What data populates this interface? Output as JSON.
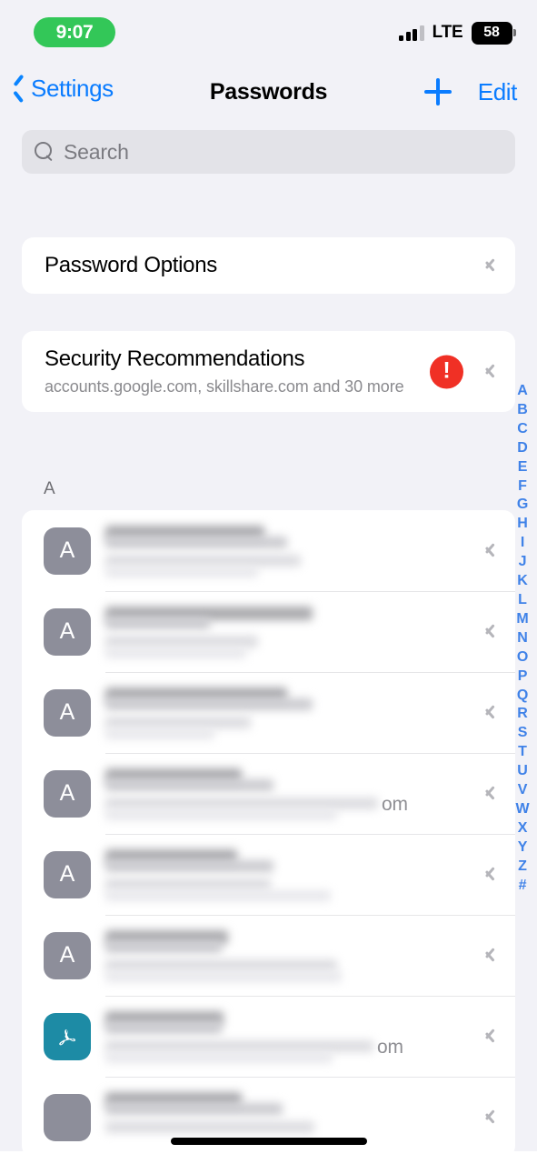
{
  "status_bar": {
    "time": "9:07",
    "time_pill_color": "#33C758",
    "carrier_tech": "LTE",
    "battery_level": "58",
    "signal_bars_filled": 3,
    "signal_bars_total": 4
  },
  "nav_bar": {
    "back_label": "Settings",
    "back_icon": "chevron-left-icon",
    "title": "Passwords",
    "add_icon": "plus-icon",
    "edit_label": "Edit",
    "accent_color": "#0A7CFF"
  },
  "search": {
    "placeholder": "Search",
    "value": "",
    "icon": "search-icon"
  },
  "password_options": {
    "label": "Password Options",
    "disclosure_icon": "chevron-right-icon"
  },
  "security_recommendations": {
    "title": "Security Recommendations",
    "subtitle": "accounts.google.com, skillshare.com and 30 more",
    "badge_icon": "exclamation-circle-icon",
    "badge_color": "#F03025",
    "disclosure_icon": "chevron-right-icon"
  },
  "section_header": "A",
  "password_list": [
    {
      "avatar_letter": "A",
      "avatar_style": "gray",
      "redacted": true,
      "title_widths": [
        175,
        200
      ],
      "sub_widths": [
        215,
        168
      ],
      "tail_text": ""
    },
    {
      "avatar_letter": "A",
      "avatar_style": "gray",
      "redacted": true,
      "title_widths": [
        228,
        115
      ],
      "sub_widths": [
        168,
        155
      ],
      "tail_text": ""
    },
    {
      "avatar_letter": "A",
      "avatar_style": "gray",
      "redacted": true,
      "title_widths": [
        200,
        228
      ],
      "sub_widths": [
        160,
        120
      ],
      "tail_text": ""
    },
    {
      "avatar_letter": "A",
      "avatar_style": "gray",
      "redacted": true,
      "title_widths": [
        150,
        185
      ],
      "sub_widths": [
        300,
        255
      ],
      "tail_text": "om"
    },
    {
      "avatar_letter": "A",
      "avatar_style": "gray",
      "redacted": true,
      "title_widths": [
        145,
        185
      ],
      "sub_widths": [
        182,
        248
      ],
      "tail_text": ""
    },
    {
      "avatar_letter": "A",
      "avatar_style": "gray",
      "redacted": true,
      "title_widths": [
        135,
        128
      ],
      "sub_widths": [
        255,
        260
      ],
      "tail_text": ""
    },
    {
      "avatar_letter": "",
      "avatar_style": "acrobat",
      "redacted": true,
      "title_widths": [
        130,
        128
      ],
      "sub_widths": [
        295,
        250
      ],
      "tail_text": "om"
    },
    {
      "avatar_letter": "",
      "avatar_style": "gray",
      "redacted": true,
      "title_widths": [
        150,
        195
      ],
      "sub_widths": [
        230,
        0
      ],
      "tail_text": ""
    }
  ],
  "index_bar": {
    "letters": [
      "A",
      "B",
      "C",
      "D",
      "E",
      "F",
      "G",
      "H",
      "I",
      "J",
      "K",
      "L",
      "M",
      "N",
      "O",
      "P",
      "Q",
      "R",
      "S",
      "T",
      "U",
      "V",
      "W",
      "X",
      "Y",
      "Z",
      "#"
    ],
    "color": "#3F82E8"
  },
  "home_indicator": {
    "visible": true
  }
}
